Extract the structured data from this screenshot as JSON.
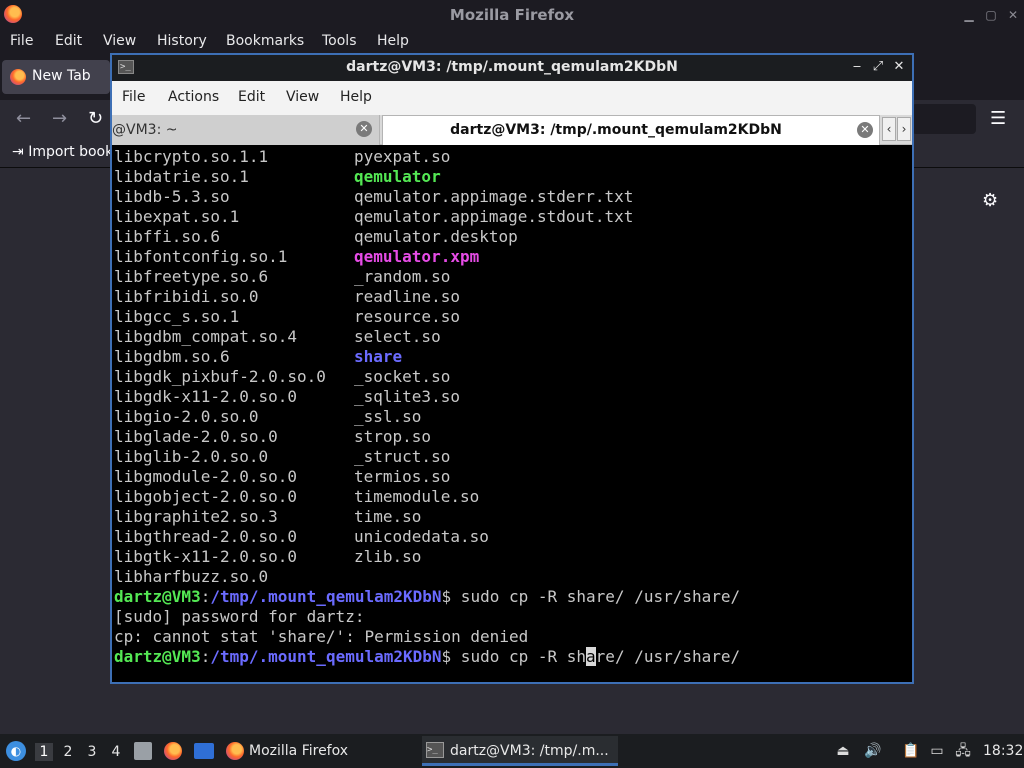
{
  "firefox": {
    "window_title": "Mozilla Firefox",
    "menu": [
      "File",
      "Edit",
      "View",
      "History",
      "Bookmarks",
      "Tools",
      "Help"
    ],
    "tab_label": "New Tab",
    "bookmarks_label": "Import book"
  },
  "terminal": {
    "window_title": "dartz@VM3: /tmp/.mount_qemulam2KDbN",
    "menu": [
      "File",
      "Actions",
      "Edit",
      "View",
      "Help"
    ],
    "tabs": [
      {
        "label": "@VM3: ~"
      },
      {
        "label": "dartz@VM3: /tmp/.mount_qemulam2KDbN"
      }
    ],
    "listing": [
      [
        "libcrypto.so.1.1",
        "pyexpat.so"
      ],
      [
        "libdatrie.so.1",
        "qemulator"
      ],
      [
        "libdb-5.3.so",
        "qemulator.appimage.stderr.txt"
      ],
      [
        "libexpat.so.1",
        "qemulator.appimage.stdout.txt"
      ],
      [
        "libffi.so.6",
        "qemulator.desktop"
      ],
      [
        "libfontconfig.so.1",
        "qemulator.xpm"
      ],
      [
        "libfreetype.so.6",
        "_random.so"
      ],
      [
        "libfribidi.so.0",
        "readline.so"
      ],
      [
        "libgcc_s.so.1",
        "resource.so"
      ],
      [
        "libgdbm_compat.so.4",
        "select.so"
      ],
      [
        "libgdbm.so.6",
        "share"
      ],
      [
        "libgdk_pixbuf-2.0.so.0",
        "_socket.so"
      ],
      [
        "libgdk-x11-2.0.so.0",
        "_sqlite3.so"
      ],
      [
        "libgio-2.0.so.0",
        "_ssl.so"
      ],
      [
        "libglade-2.0.so.0",
        "strop.so"
      ],
      [
        "libglib-2.0.so.0",
        "_struct.so"
      ],
      [
        "libgmodule-2.0.so.0",
        "termios.so"
      ],
      [
        "libgobject-2.0.so.0",
        "timemodule.so"
      ],
      [
        "libgraphite2.so.3",
        "time.so"
      ],
      [
        "libgthread-2.0.so.0",
        "unicodedata.so"
      ],
      [
        "libgtk-x11-2.0.so.0",
        "zlib.so"
      ],
      [
        "libharfbuzz.so.0",
        ""
      ]
    ],
    "prompt_user": "dartz@VM3",
    "prompt_sep": ":",
    "prompt_path": "/tmp/.mount_qemulam2KDbN",
    "prompt_dollar": "$",
    "command1": " sudo cp -R share/ /usr/share/",
    "sudo_prompt": "[sudo] password for dartz:",
    "error": "cp: cannot stat 'share/': Permission denied",
    "command2_before_cursor": " sudo cp -R sh",
    "command2_cursor": "a",
    "command2_after_cursor": "re/ /usr/share/"
  },
  "taskbar": {
    "workspaces": [
      "1",
      "2",
      "3",
      "4"
    ],
    "tasks": [
      {
        "label": "Mozilla Firefox"
      },
      {
        "label": "dartz@VM3: /tmp/.m..."
      }
    ],
    "clock": "18:32"
  },
  "colors": {
    "exec": "#54e854",
    "xpm": "#e74ce7",
    "dir": "#6b6bff",
    "terminal_border": "#3d6fb5"
  }
}
